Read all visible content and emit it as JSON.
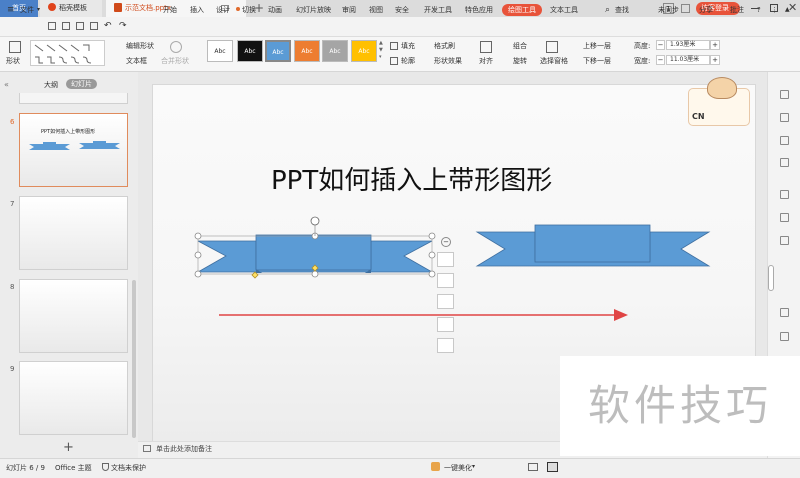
{
  "tabs": {
    "home": "首页",
    "template": "稻壳模板",
    "document": "示范文档.pptx",
    "add": "+"
  },
  "window": {
    "page_num": "1",
    "login": "访客登录"
  },
  "menu": {
    "file": "文件",
    "items": [
      "开始",
      "插入",
      "设计",
      "切换",
      "动画",
      "幻灯片放映",
      "审阅",
      "视图",
      "安全",
      "开发工具",
      "特色应用"
    ],
    "active": "绘图工具",
    "text_tool": "文本工具",
    "search": "查找",
    "sync": "未同步",
    "share": "分享",
    "comment": "批注"
  },
  "ribbon": {
    "shape": "形状",
    "edit_shape": "编辑形状",
    "textbox": "文本框",
    "merge_shape": "合并形状",
    "styles": [
      "Abc",
      "Abc",
      "Abc",
      "Abc",
      "Abc",
      "Abc"
    ],
    "style_colors": [
      "#ffffff",
      "#111111",
      "#5b9bd5",
      "#ed7d31",
      "#a5a5a5",
      "#ffc000"
    ],
    "fill": "填充",
    "format_brush": "格式刷",
    "outline": "轮廓",
    "shape_effect": "形状效果",
    "align": "对齐",
    "group": "组合",
    "rotate": "旋转",
    "select_pane": "选择窗格",
    "bring_forward": "上移一层",
    "send_backward": "下移一层",
    "height_label": "高度:",
    "height_value": "1.93厘米",
    "width_label": "宽度:",
    "width_value": "11.03厘米"
  },
  "panel": {
    "outline_tab": "大纲",
    "slides_tab": "幻灯片",
    "add": "+",
    "thumbs": [
      {
        "num": "6",
        "title": "PPT如何插入上带形图形"
      },
      {
        "num": "7"
      },
      {
        "num": "8"
      },
      {
        "num": "9"
      }
    ]
  },
  "slide": {
    "title": "PPT如何插入上带形图形",
    "badge_text": "CN"
  },
  "notes": {
    "placeholder": "单击此处添加备注"
  },
  "status": {
    "slide_info": "幻灯片 6 / 9",
    "theme": "Office 主题",
    "protect": "文档未保护",
    "beautify": "一键美化"
  },
  "watermark": "软件技巧"
}
